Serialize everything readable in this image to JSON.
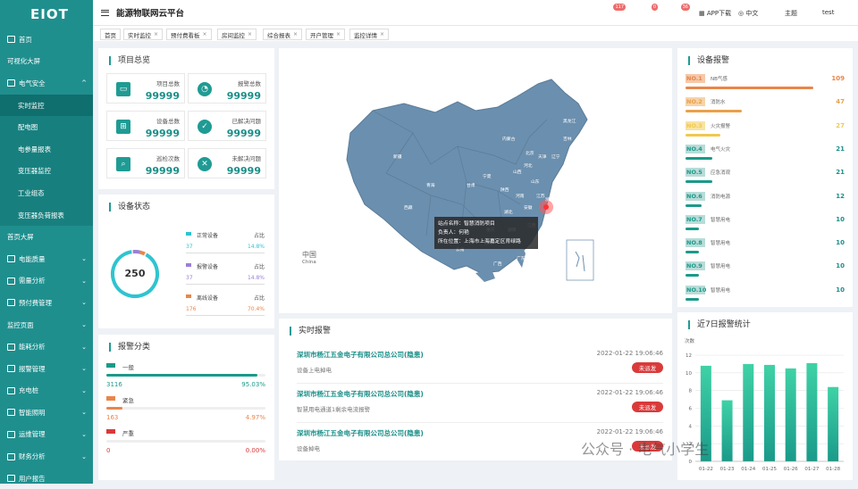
{
  "app": {
    "logo": "EIOT",
    "title": "能源物联网云平台"
  },
  "sidebar": {
    "items": [
      {
        "label": "首页",
        "icon": "home-icon",
        "sub": false
      },
      {
        "label": "可视化大屏",
        "icon": "",
        "sub": false
      },
      {
        "label": "电气安全",
        "icon": "shield-icon",
        "sub": false,
        "chev": "^"
      },
      {
        "label": "实时监控",
        "sub": true,
        "active": true
      },
      {
        "label": "配电图",
        "sub": true
      },
      {
        "label": "电参量报表",
        "sub": true
      },
      {
        "label": "变压器监控",
        "sub": true
      },
      {
        "label": "工业组态",
        "sub": true
      },
      {
        "label": "变压器负荷报表",
        "sub": true
      },
      {
        "label": "首页大屏",
        "sub": false
      },
      {
        "label": "电能质量",
        "icon": "power-icon",
        "sub": false,
        "chev": "⌄"
      },
      {
        "label": "需量分析",
        "icon": "chart-icon",
        "sub": false,
        "chev": "⌄"
      },
      {
        "label": "预付费管理",
        "icon": "user-icon",
        "sub": false,
        "chev": "⌄"
      },
      {
        "label": "监控页面",
        "sub": false,
        "chev": "⌄"
      },
      {
        "label": "能耗分析",
        "icon": "bar-icon",
        "sub": false,
        "chev": "⌄"
      },
      {
        "label": "报警管理",
        "icon": "alarm-icon",
        "sub": false,
        "chev": "⌄"
      },
      {
        "label": "充电桩",
        "icon": "charger-icon",
        "sub": false,
        "chev": "⌄"
      },
      {
        "label": "智能照明",
        "icon": "bulb-icon",
        "sub": false,
        "chev": "⌄"
      },
      {
        "label": "运维管理",
        "icon": "tool-icon",
        "sub": false,
        "chev": "⌄"
      },
      {
        "label": "财务分析",
        "icon": "money-icon",
        "sub": false,
        "chev": "⌄"
      },
      {
        "label": "用户报告",
        "icon": "doc-icon",
        "sub": false
      }
    ]
  },
  "topbar": {
    "alarms": [
      {
        "label": "一般",
        "count": "117",
        "color": "#1a9a8a"
      },
      {
        "label": "紧急",
        "count": "0",
        "color": "#e8a04a"
      },
      {
        "label": "严重",
        "count": "36",
        "color": "#e86a6a"
      }
    ],
    "app_download": "APP下载",
    "language": "中文",
    "theme": "主题",
    "user": "test"
  },
  "tabs": [
    {
      "label": "首页",
      "close": false
    },
    {
      "label": "实时监控",
      "close": true
    },
    {
      "label": "预付费看板",
      "close": true
    },
    {
      "label": "房间监控",
      "close": true
    },
    {
      "label": "综合报表",
      "close": true
    },
    {
      "label": "开户管理",
      "close": true
    },
    {
      "label": "监控详情",
      "close": true
    }
  ],
  "overview": {
    "title": "项目总览",
    "stats": [
      {
        "label": "项目总数",
        "value": "99999",
        "icon": "folder-icon"
      },
      {
        "label": "报警总数",
        "value": "99999",
        "icon": "pie-icon"
      },
      {
        "label": "设备总数",
        "value": "99999",
        "icon": "device-icon"
      },
      {
        "label": "已解决问题",
        "value": "99999",
        "icon": "check-icon"
      },
      {
        "label": "巡检次数",
        "value": "99999",
        "icon": "inspect-icon"
      },
      {
        "label": "未解决问题",
        "value": "99999",
        "icon": "x-circle-icon"
      }
    ]
  },
  "device_status": {
    "title": "设备状态",
    "total": "250",
    "items": [
      {
        "name": "正常设备",
        "ratio_label": "占比",
        "count": "37",
        "pct": "14.8%",
        "color": "#2ec4d0"
      },
      {
        "name": "报警设备",
        "ratio_label": "占比",
        "count": "37",
        "pct": "14.8%",
        "color": "#9b7fd6"
      },
      {
        "name": "离线设备",
        "ratio_label": "占比",
        "count": "176",
        "pct": "70.4%",
        "color": "#e8864a"
      }
    ]
  },
  "alarm_class": {
    "title": "报警分类",
    "items": [
      {
        "name": "一般",
        "count": "3116",
        "pct": "95.03%",
        "fill": 0.95,
        "color": "#1a9a8a"
      },
      {
        "name": "紧急",
        "count": "163",
        "pct": "4.97%",
        "fill": 0.1,
        "color": "#e8864a"
      },
      {
        "name": "严重",
        "count": "0",
        "pct": "0.00%",
        "fill": 0.0,
        "color": "#d93a3a"
      }
    ]
  },
  "map": {
    "tooltip": {
      "site": "站点名称：智慧消防项目",
      "person": "负责人：何艳",
      "location": "所在位置：上海市上海嘉定区育绿路"
    },
    "legend_cn": "中国",
    "legend_en": "China",
    "provinces": [
      "黑龙江",
      "吉林",
      "辽宁",
      "内蒙古",
      "新疆",
      "西藏",
      "青海",
      "甘肃",
      "宁夏",
      "陕西",
      "山西",
      "河北",
      "北京",
      "天津",
      "山东",
      "河南",
      "江苏",
      "安徽",
      "湖北",
      "四川",
      "重庆",
      "贵州",
      "云南",
      "湖南",
      "江西",
      "浙江",
      "福建",
      "广西",
      "广东",
      "海南",
      "台湾",
      "上海"
    ]
  },
  "realtime": {
    "title": "实时报警",
    "alerts": [
      {
        "company": "深圳市杨江五金电子有限公司总公司(隐患)",
        "time": "2022-01-22  19:06:46",
        "desc": "设备上电掉电",
        "badge": "未派发"
      },
      {
        "company": "深圳市杨江五金电子有限公司总公司(隐患)",
        "time": "2022-01-22  19:06:46",
        "desc": "智慧用电通道1剩余电流报警",
        "badge": "未派发"
      },
      {
        "company": "深圳市杨江五金电子有限公司总公司(隐患)",
        "time": "2022-01-22  19:06:46",
        "desc": "设备掉电",
        "badge": "未派发"
      }
    ]
  },
  "ranking": {
    "title": "设备报警",
    "items": [
      {
        "no": "NO.1",
        "name": "NB气感",
        "value": "109",
        "bar": 0.95,
        "color": "#e8864a"
      },
      {
        "no": "NO.2",
        "name": "消防水",
        "value": "47",
        "bar": 0.42,
        "color": "#e8a04a"
      },
      {
        "no": "NO.3",
        "name": "火灾报警",
        "value": "27",
        "bar": 0.26,
        "color": "#f0c850"
      },
      {
        "no": "NO.4",
        "name": "电气火灾",
        "value": "21",
        "bar": 0.2,
        "color": "#1a9a8a"
      },
      {
        "no": "NO.5",
        "name": "应急消观",
        "value": "21",
        "bar": 0.2,
        "color": "#1a9a8a"
      },
      {
        "no": "NO.6",
        "name": "消防电源",
        "value": "12",
        "bar": 0.12,
        "color": "#1a9a8a"
      },
      {
        "no": "NO.7",
        "name": "智慧用电",
        "value": "10",
        "bar": 0.1,
        "color": "#1a9a8a"
      },
      {
        "no": "NO.8",
        "name": "智慧用电",
        "value": "10",
        "bar": 0.1,
        "color": "#1a9a8a"
      },
      {
        "no": "NO.9",
        "name": "智慧用电",
        "value": "10",
        "bar": 0.1,
        "color": "#1a9a8a"
      },
      {
        "no": "NO.10",
        "name": "智慧用电",
        "value": "10",
        "bar": 0.1,
        "color": "#1a9a8a"
      }
    ]
  },
  "weekly": {
    "title": "近7日报警统计"
  },
  "chart_data": {
    "type": "bar",
    "title": "近7日报警统计",
    "ylabel": "次数",
    "categories": [
      "01-22",
      "01-23",
      "01-24",
      "01-25",
      "01-26",
      "01-27",
      "01-28"
    ],
    "values": [
      10.8,
      6.9,
      11,
      10.9,
      10.5,
      11.1,
      8.4
    ],
    "ylim": [
      0,
      12
    ],
    "yticks": [
      0,
      2,
      4,
      6,
      8,
      10,
      12
    ],
    "grid": true,
    "colors": [
      "#3fd2a6",
      "#1a9a8a"
    ]
  },
  "watermark": "公众号 · 电气小学生"
}
